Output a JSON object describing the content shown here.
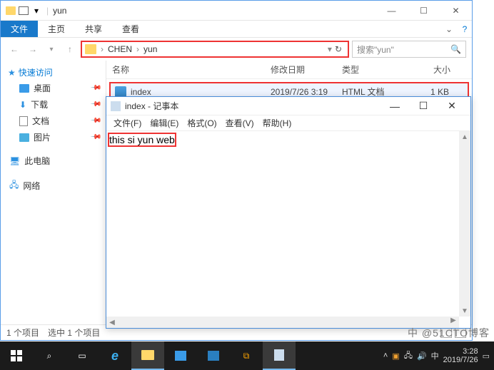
{
  "explorer": {
    "title": "yun",
    "tabs": {
      "file": "文件",
      "home": "主页",
      "share": "共享",
      "view": "查看"
    },
    "breadcrumb": {
      "p1": "CHEN",
      "p2": "yun"
    },
    "search": {
      "placeholder": "搜索\"yun\""
    },
    "sidebar": {
      "quick": "快速访问",
      "items": [
        "桌面",
        "下载",
        "文档",
        "图片"
      ],
      "pc": "此电脑",
      "net": "网络"
    },
    "columns": {
      "name": "名称",
      "date": "修改日期",
      "type": "类型",
      "size": "大小"
    },
    "file": {
      "name": "index",
      "date": "2019/7/26 3:19",
      "type": "HTML 文档",
      "size": "1 KB"
    },
    "status": {
      "count": "1 个项目",
      "selected": "选中 1 个项目"
    }
  },
  "notepad": {
    "title": "index - 记事本",
    "menu": {
      "file": "文件(F)",
      "edit": "编辑(E)",
      "format": "格式(O)",
      "view": "查看(V)",
      "help": "帮助(H)"
    },
    "content": "this si yun web"
  },
  "taskbar": {
    "ime": "中",
    "time": "3:28",
    "date": "2019/7/26"
  },
  "watermark": "中 @51CTO博客"
}
